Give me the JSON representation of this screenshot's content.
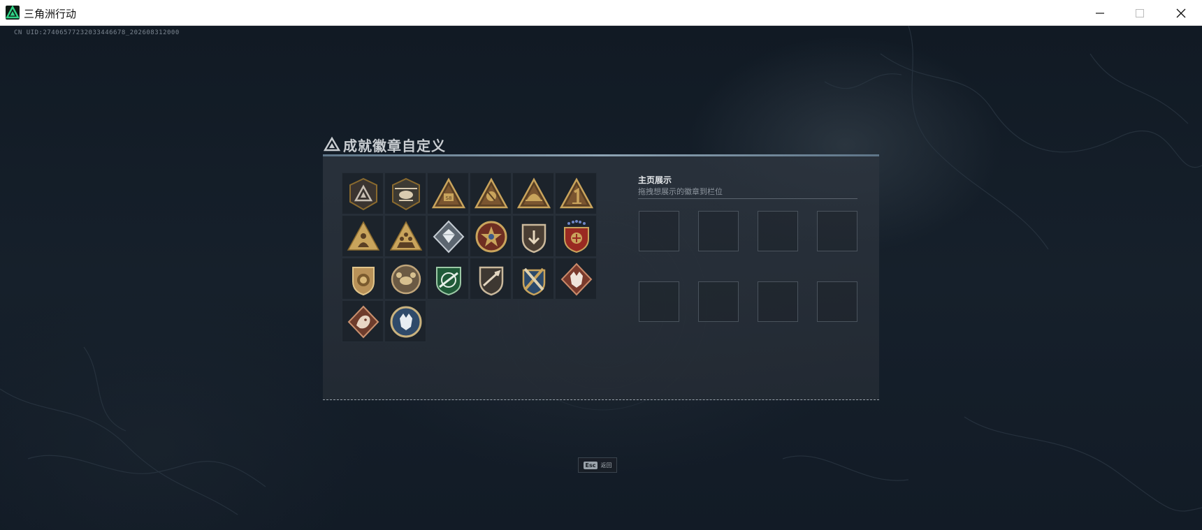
{
  "window": {
    "app_icon": "delta-triangle-icon",
    "title": "三角洲行动",
    "controls": [
      "minimize-icon",
      "maximize-icon",
      "close-icon"
    ]
  },
  "game": {
    "uid": "CN UID:27406577232033446678_202608312000"
  },
  "panel": {
    "title_icon": "delta-triangle-icon",
    "title": "成就徽章自定义",
    "badges": [
      {
        "icon": "delta-triangle-badge-icon"
      },
      {
        "icon": "helicopter-badge-icon"
      },
      {
        "icon": "s8-triangle-badge-icon"
      },
      {
        "icon": "emblem-triangle-badge-icon"
      },
      {
        "icon": "helmet-triangle-badge-icon"
      },
      {
        "icon": "number-one-triangle-badge-icon"
      },
      {
        "icon": "soldier-triangle-badge-icon"
      },
      {
        "icon": "troops-triangle-badge-icon"
      },
      {
        "icon": "crystal-diamond-badge-icon"
      },
      {
        "icon": "star-ring-badge-icon"
      },
      {
        "icon": "down-arrow-shield-badge-icon"
      },
      {
        "icon": "starred-shield-badge-icon"
      },
      {
        "icon": "lion-shield-badge-icon"
      },
      {
        "icon": "crab-circle-badge-icon"
      },
      {
        "icon": "rifle-crosshair-badge-icon"
      },
      {
        "icon": "dagger-shield-badge-icon"
      },
      {
        "icon": "crossed-rockets-badge-icon"
      },
      {
        "icon": "wolf-diamond-badge-icon"
      },
      {
        "icon": "dragon-diamond-badge-icon"
      },
      {
        "icon": "wolf-circle-badge-icon"
      }
    ],
    "display": {
      "title": "主页展示",
      "subtitle": "拖拽想展示的徽章到栏位",
      "slots": 8
    }
  },
  "footer": {
    "key": "Esc",
    "label": "返回"
  }
}
